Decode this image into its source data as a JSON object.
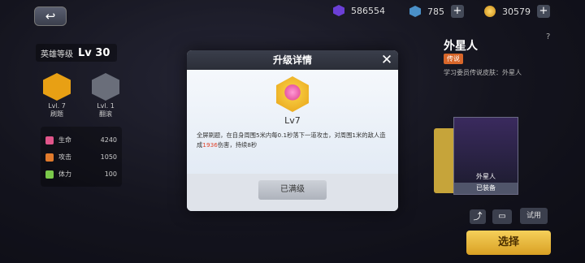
{
  "top_bar": {
    "purple_gems": "586554",
    "blue_gems": "785",
    "coins": "30579"
  },
  "hero": {
    "level_label": "英雄等级",
    "level_value": "Lv 30",
    "skills": [
      {
        "level": "Lvl. 7",
        "name": "刷题",
        "color": "#e8a014"
      },
      {
        "level": "Lvl. 1",
        "name": "翻滚",
        "color": "#6a6e7a"
      }
    ],
    "stats": [
      {
        "name": "生命",
        "value": "4240",
        "color": "#e0558a"
      },
      {
        "name": "攻击",
        "value": "1050",
        "color": "#e07a2c"
      },
      {
        "name": "体力",
        "value": "100",
        "color": "#7ac84a"
      }
    ]
  },
  "right_panel": {
    "help": "?",
    "character_name": "外星人",
    "rarity_tag": "传说",
    "skin_desc": "学习委员传说皮肤：外星人",
    "card_name": "外星人",
    "card_status": "已装备",
    "try_label": "试用",
    "select_label": "选择"
  },
  "dialog": {
    "title": "升级详情",
    "close": "✕",
    "skill_level": "Lv7",
    "desc_part1": "全屏刷题，在自身周围5米内每0.1秒落下一道攻击，对周围1米的敌人造成",
    "desc_damage": "1936",
    "desc_part2": "伤害，持续8秒",
    "maxed_label": "已满级"
  }
}
